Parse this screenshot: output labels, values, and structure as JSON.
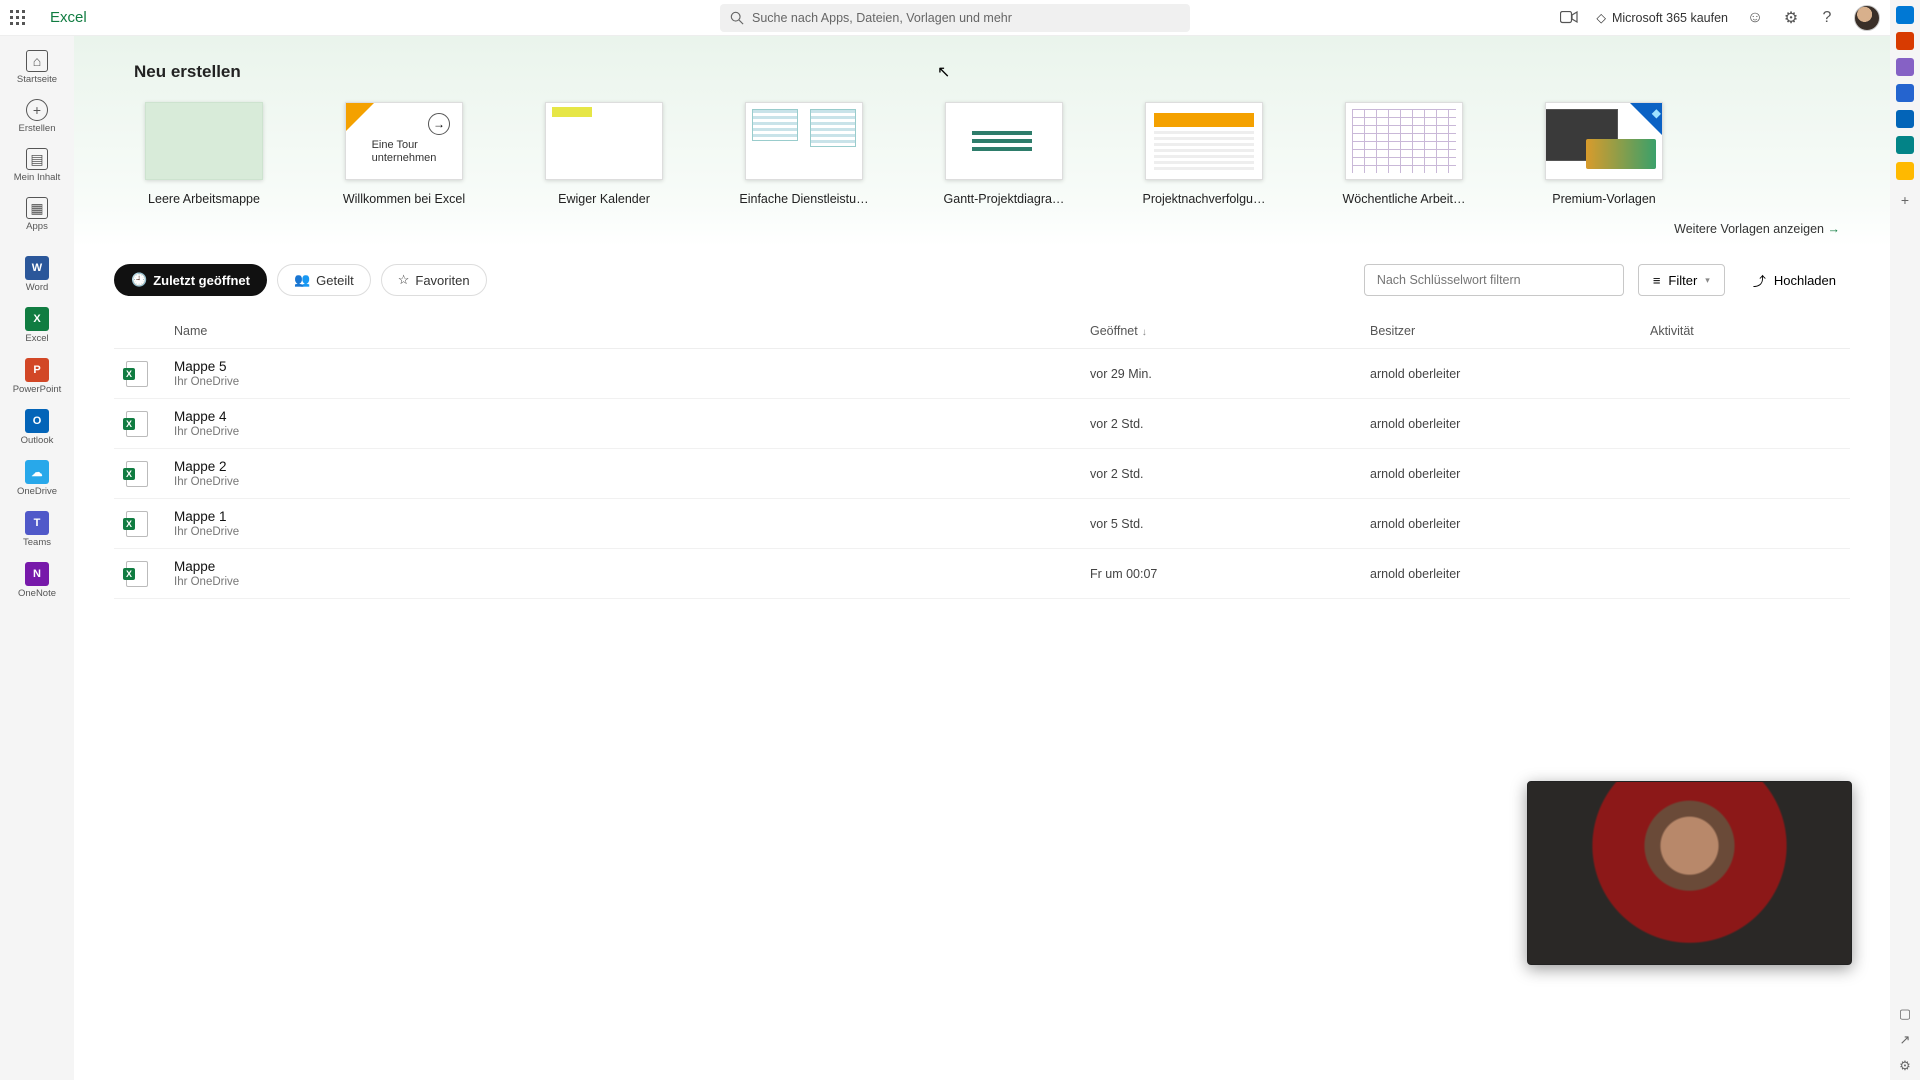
{
  "header": {
    "app_title": "Excel",
    "search_placeholder": "Suche nach Apps, Dateien, Vorlagen und mehr",
    "buy_label": "Microsoft 365 kaufen"
  },
  "left_nav": {
    "home": "Startseite",
    "create": "Erstellen",
    "my_content": "Mein Inhalt",
    "apps": "Apps",
    "word": "Word",
    "excel": "Excel",
    "powerpoint": "PowerPoint",
    "outlook": "Outlook",
    "onedrive": "OneDrive",
    "teams": "Teams",
    "onenote": "OneNote"
  },
  "hero": {
    "title": "Neu erstellen",
    "templates": [
      {
        "label": "Leere Arbeitsmappe"
      },
      {
        "label": "Willkommen bei Excel",
        "tour_line1": "Eine Tour",
        "tour_line2": "unternehmen"
      },
      {
        "label": "Ewiger Kalender"
      },
      {
        "label": "Einfache Dienstleistu…"
      },
      {
        "label": "Gantt-Projektdiagra…"
      },
      {
        "label": "Projektnachverfolgu…"
      },
      {
        "label": "Wöchentliche Arbeit…"
      },
      {
        "label": "Premium-Vorlagen"
      }
    ],
    "more": "Weitere Vorlagen anzeigen"
  },
  "tabs": {
    "recent": "Zuletzt geöffnet",
    "shared": "Geteilt",
    "favorites": "Favoriten"
  },
  "toolbar": {
    "filter_placeholder": "Nach Schlüsselwort filtern",
    "filter_btn": "Filter",
    "upload_btn": "Hochladen"
  },
  "columns": {
    "name": "Name",
    "opened": "Geöffnet",
    "owner": "Besitzer",
    "activity": "Aktivität"
  },
  "files": [
    {
      "name": "Mappe 5",
      "location": "Ihr OneDrive",
      "opened": "vor 29 Min.",
      "owner": "arnold oberleiter"
    },
    {
      "name": "Mappe 4",
      "location": "Ihr OneDrive",
      "opened": "vor 2 Std.",
      "owner": "arnold oberleiter"
    },
    {
      "name": "Mappe 2",
      "location": "Ihr OneDrive",
      "opened": "vor 2 Std.",
      "owner": "arnold oberleiter"
    },
    {
      "name": "Mappe 1",
      "location": "Ihr OneDrive",
      "opened": "vor 5 Std.",
      "owner": "arnold oberleiter"
    },
    {
      "name": "Mappe",
      "location": "Ihr OneDrive",
      "opened": "Fr um 00:07",
      "owner": "arnold oberleiter"
    }
  ]
}
